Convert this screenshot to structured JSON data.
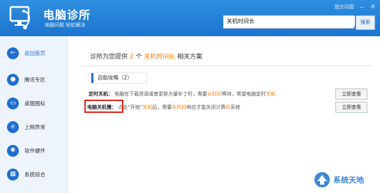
{
  "header": {
    "app_title": "电脑诊所",
    "app_subtitle": "电脑问题  轻松解决",
    "report_issue": "提交问题",
    "minimize": "—",
    "close": "×",
    "search_value": "关机时间长",
    "search_button": "搜索"
  },
  "sidebar": {
    "items": [
      {
        "label": "返回首页",
        "icon": "back-arrow-icon",
        "glyph": "←"
      },
      {
        "label": "腾讯专区",
        "icon": "penguin-icon",
        "glyph": "●"
      },
      {
        "label": "桌面图标",
        "icon": "monitor-icon",
        "glyph": "▭"
      },
      {
        "label": "上网异常",
        "icon": "ie-icon",
        "glyph": "e"
      },
      {
        "label": "软件硬件",
        "icon": "gear-icon",
        "glyph": "✱"
      },
      {
        "label": "系统综合",
        "icon": "grid-icon",
        "glyph": "▦"
      }
    ]
  },
  "main": {
    "diag_prefix": "诊所为您提供",
    "diag_count": "2",
    "diag_mid": "个",
    "diag_keyword": "关机时间长",
    "diag_suffix": "相关方案",
    "section_title": "自助攻略（2）",
    "rows": [
      {
        "title_a": "定时",
        "title_hl": "关机",
        "title_b": "：",
        "desc_a": "电脑在下载资源或者更新大量补丁时，需要",
        "desc_hl": "长时间",
        "desc_b": "等待，希望电脑定时",
        "desc_hl2": "关机",
        "button": "立即查看"
      },
      {
        "title_a": "电脑",
        "title_hl": "关机",
        "title_b": "慢：",
        "desc_a": "点击“开始”",
        "desc_hl": "关机",
        "desc_b": "后，需要",
        "desc_hl2": "长时间",
        "desc_c": "响应才能关闭计算",
        "desc_hl3": "机",
        "desc_d": "系统",
        "button": "立即查看"
      }
    ]
  },
  "watermark": {
    "text": "系统天地"
  },
  "colors": {
    "header": "#1c74cf",
    "accent": "#ff7a00",
    "highlight_box": "#e0231a"
  }
}
